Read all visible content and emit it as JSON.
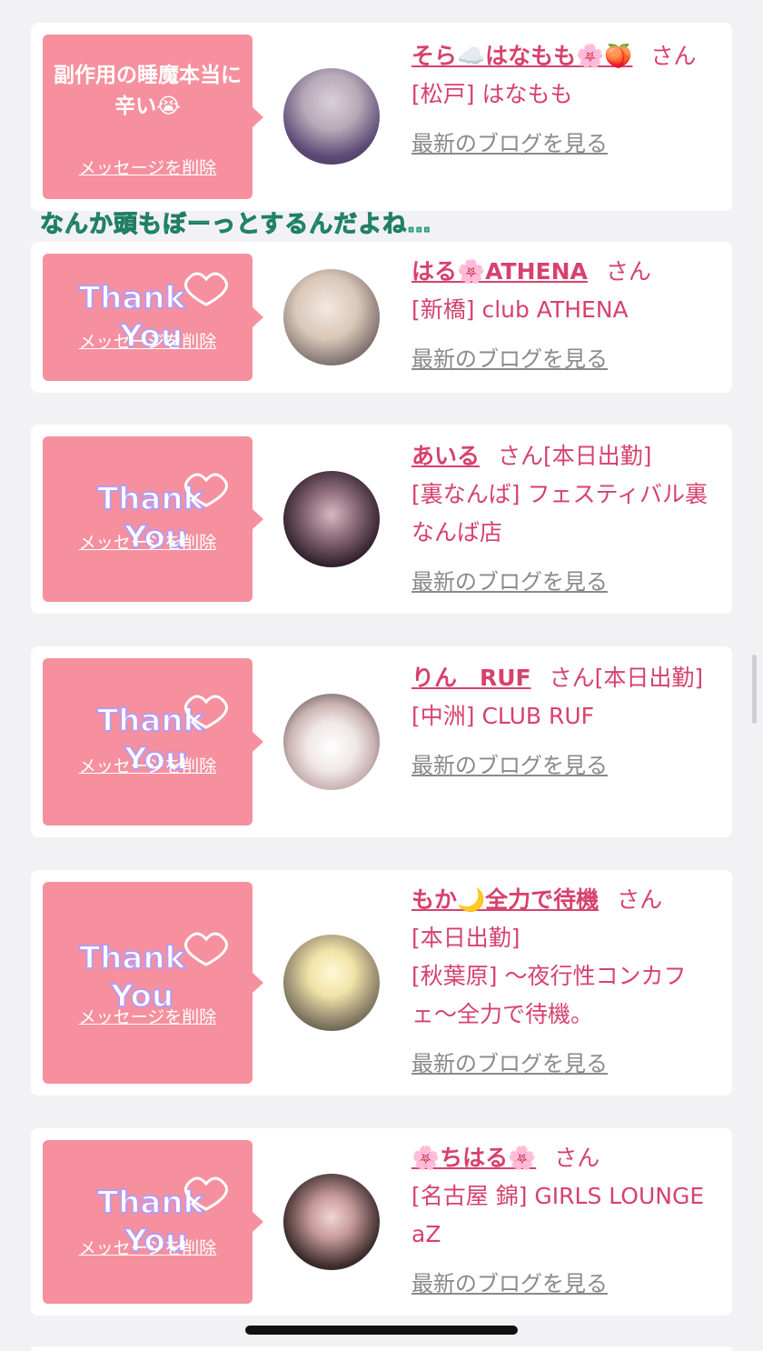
{
  "overlay_caption": "なんか頭もぼーっとするんだよね…",
  "delete_label": "メッセージを削除",
  "blog_label": "最新のブログを見る",
  "san": "さん",
  "cards": [
    {
      "message": "副作用の睡魔本当に辛い😭",
      "name": "そら☁️はなもも🌸🍑",
      "location_shop": "[松戸] はなもも",
      "status": ""
    },
    {
      "message": "",
      "name": "はる🌸ATHENA",
      "location_shop": "[新橋] club ATHENA",
      "status": ""
    },
    {
      "message": "",
      "name": "あいる",
      "location_shop": "[裏なんば] フェスティバル裏なんば店",
      "status": "[本日出勤]"
    },
    {
      "message": "",
      "name": "りん　RUF",
      "location_shop": "[中洲] CLUB RUF",
      "status": "[本日出勤]"
    },
    {
      "message": "",
      "name": "もか🌙全力で待機",
      "location_shop": "[秋葉原] 〜夜行性コンカフェ〜全力で待機。",
      "status": "[本日出勤]"
    },
    {
      "message": "",
      "name": "🌸ちはる🌸",
      "location_shop": "[名古屋 錦] GIRLS LOUNGE aZ",
      "status": ""
    }
  ],
  "sticker": {
    "line1": "Thank",
    "line2": "You"
  },
  "colors": {
    "accent": "#d6426d",
    "bubble": "#f6909e",
    "background": "#f2f2f4",
    "link_gray": "#8a8a8a"
  }
}
